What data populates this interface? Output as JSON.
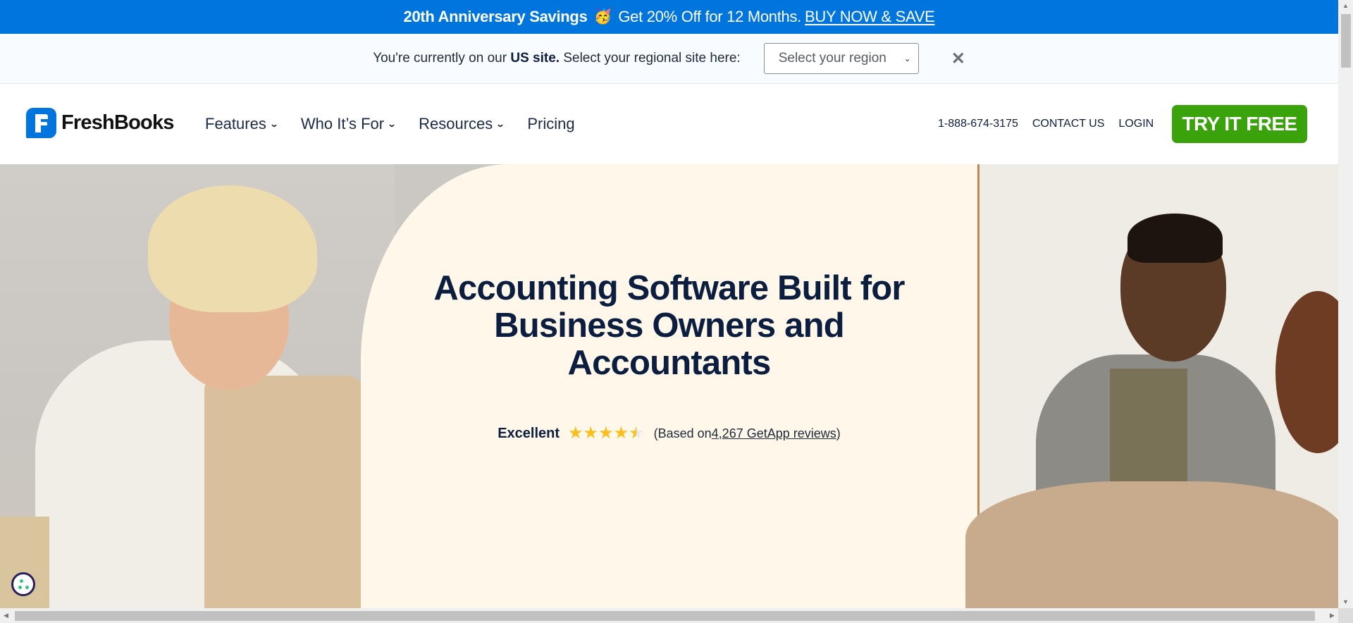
{
  "promo": {
    "headline": "20th Anniversary Savings",
    "emoji": "🥳",
    "offer": "Get 20% Off for 12 Months.",
    "cta": "BUY NOW & SAVE"
  },
  "region_bar": {
    "prefix": "You're currently on our",
    "site": "US site.",
    "suffix": "Select your regional site here:",
    "select_value": "Select your region",
    "close_icon": "close-icon"
  },
  "nav": {
    "brand": "FreshBooks",
    "items": [
      {
        "label": "Features",
        "has_dropdown": true
      },
      {
        "label": "Who It’s For",
        "has_dropdown": true
      },
      {
        "label": "Resources",
        "has_dropdown": true
      },
      {
        "label": "Pricing",
        "has_dropdown": false
      }
    ],
    "phone": "1-888-674-3175",
    "contact": "CONTACT US",
    "login": "LOGIN",
    "cta": "TRY IT FREE",
    "cta_color": "#3aa20b",
    "brand_color": "#0075dd"
  },
  "hero": {
    "headline_lines": [
      "Accounting Software Built for",
      "Business Owners and",
      "Accountants"
    ],
    "rating_label": "Excellent",
    "rating_value": 4.5,
    "rating_max": 5,
    "review_prefix": "(Based on ",
    "review_link": "4,267 GetApp reviews",
    "review_suffix": ")",
    "background_color": "#fff8ea"
  },
  "cookie_icon": "cookie-settings-icon"
}
